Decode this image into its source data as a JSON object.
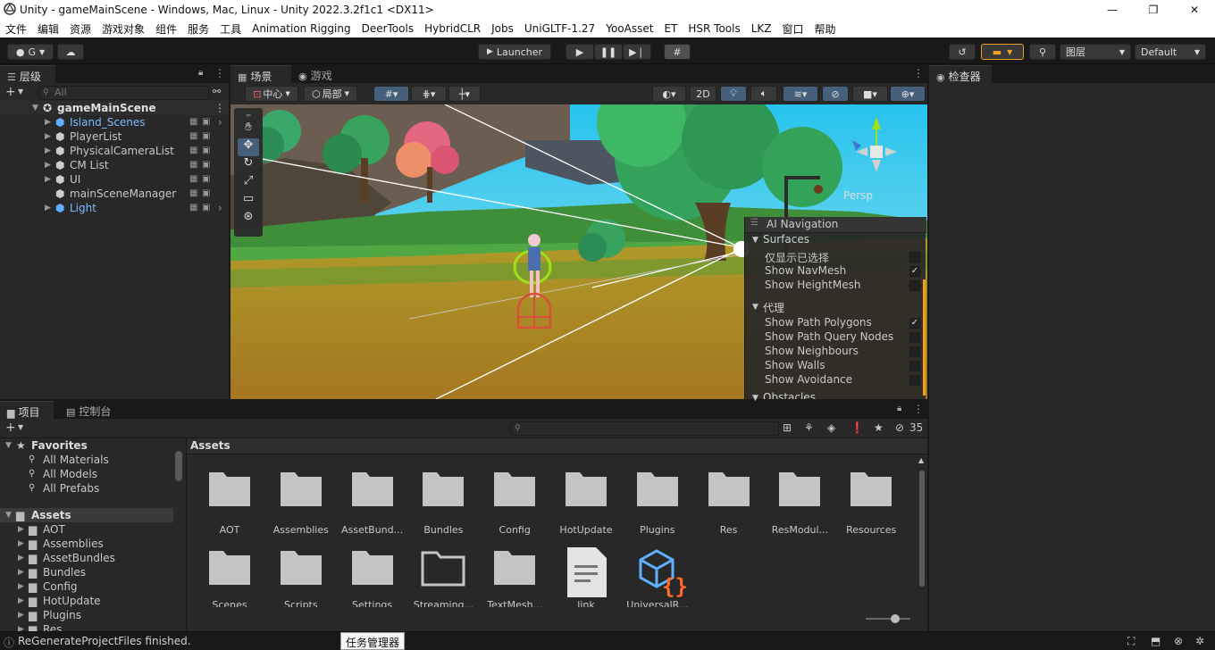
{
  "window": {
    "title": "Unity - gameMainScene - Windows, Mac, Linux - Unity 2022.3.2f1c1 <DX11>",
    "minimize": "—",
    "maximize": "❐",
    "close": "✕"
  },
  "menu": [
    "文件",
    "编辑",
    "资源",
    "游戏对象",
    "组件",
    "服务",
    "工具",
    "Animation Rigging",
    "DeerTools",
    "HybridCLR",
    "Jobs",
    "UniGLTF-1.27",
    "YooAsset",
    "ET",
    "HSR Tools",
    "LKZ",
    "窗口",
    "帮助"
  ],
  "toolbar": {
    "account": "G",
    "launcher": "Launcher",
    "layers": "图层",
    "layout": "Default"
  },
  "hierarchy": {
    "tab": "层级",
    "search_placeholder": "All",
    "scene": "gameMainScene",
    "items": [
      {
        "label": "Island_Scenes",
        "blue": true
      },
      {
        "label": "PlayerList",
        "blue": false
      },
      {
        "label": "PhysicalCameraList",
        "blue": false
      },
      {
        "label": "CM List",
        "blue": false
      },
      {
        "label": "UI",
        "blue": false
      },
      {
        "label": "mainSceneManager",
        "blue": false
      },
      {
        "label": "Light",
        "blue": true
      }
    ]
  },
  "scene_view": {
    "tab_scene": "场景",
    "tab_game": "游戏",
    "pivot": "中心",
    "space": "局部",
    "mode_2d": "2D",
    "persp": "Persp"
  },
  "ai_navigation": {
    "title": "AI Navigation",
    "surfaces": "Surfaces",
    "surface_items": [
      {
        "label": "仅显示已选择",
        "checked": false
      },
      {
        "label": "Show NavMesh",
        "checked": true
      },
      {
        "label": "Show HeightMesh",
        "checked": false
      }
    ],
    "agent": "代理",
    "agent_items": [
      {
        "label": "Show Path Polygons",
        "checked": true
      },
      {
        "label": "Show Path Query Nodes",
        "checked": false
      },
      {
        "label": "Show Neighbours",
        "checked": false
      },
      {
        "label": "Show Walls",
        "checked": false
      },
      {
        "label": "Show Avoidance",
        "checked": false
      }
    ],
    "obstacles": "Obstacles"
  },
  "inspector": {
    "tab": "检查器"
  },
  "project": {
    "tab_project": "项目",
    "tab_console": "控制台",
    "hidden_count": "35",
    "favorites": "Favorites",
    "fav_items": [
      "All Materials",
      "All Models",
      "All Prefabs"
    ],
    "assets": "Assets",
    "asset_tree": [
      "AOT",
      "Assemblies",
      "AssetBundles",
      "Bundles",
      "Config",
      "HotUpdate",
      "Plugins",
      "Res"
    ],
    "breadcrumb": "Assets",
    "grid_row1": [
      "AOT",
      "Assemblies",
      "AssetBund...",
      "Bundles",
      "Config",
      "HotUpdate",
      "Plugins",
      "Res",
      "ResModul...",
      "Resources"
    ],
    "grid_row2": [
      "Scenes",
      "Scripts",
      "Settings",
      "Streaming...",
      "TextMesh...",
      "link",
      "UniversalR..."
    ]
  },
  "status": {
    "message": "ReGenerateProjectFiles finished.",
    "tooltip": "任务管理器"
  },
  "colors": {
    "accent": "#46607c",
    "link": "#7fb9ff",
    "orange": "#f0a020"
  }
}
